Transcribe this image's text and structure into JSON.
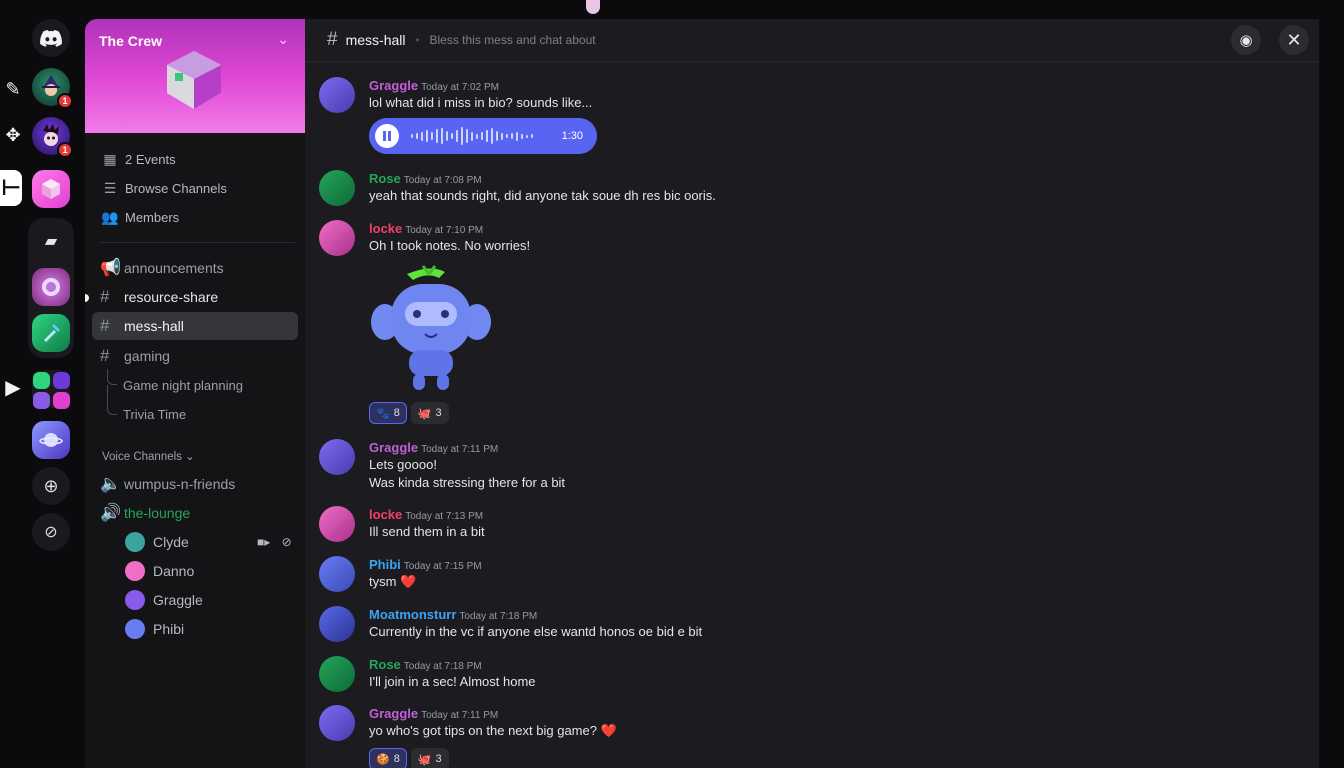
{
  "server": {
    "name": "The Crew",
    "badges": [
      "1",
      "1"
    ]
  },
  "sidebar": {
    "meta_items": [
      {
        "label": "2 Events",
        "icon": "calendar-icon"
      },
      {
        "label": "Browse Channels",
        "icon": "browse-channels-icon"
      },
      {
        "label": "Members",
        "icon": "members-icon"
      }
    ],
    "channels": [
      {
        "label": "announcements",
        "icon": "megaphone-icon"
      },
      {
        "label": "resource-share",
        "icon": "hash-icon"
      },
      {
        "label": "mess-hall",
        "icon": "hash-icon",
        "active": true
      },
      {
        "label": "gaming",
        "icon": "hash-icon"
      }
    ],
    "threads": [
      "Game night planning",
      "Trivia Time"
    ],
    "voice_section_label": "Voice Channels",
    "voice_channels": [
      "wumpus-n-friends",
      "the-lounge"
    ],
    "voice_users": [
      "Clyde",
      "Danno",
      "Graggle",
      "Phibi"
    ]
  },
  "chat": {
    "channel": "mess-hall",
    "topic": "Bless this mess and chat about",
    "voice_duration": "1:30",
    "messages": [
      {
        "author": "Graggle",
        "time": "Today at 7:02 PM",
        "lines": [
          "lol what did i miss in bio? sounds like..."
        ],
        "color": "#c25fd6"
      },
      {
        "author": "Rose",
        "time": "Today at 7:08 PM",
        "lines": [
          "yeah that sounds right, did anyone tak soue dh res bic ooris."
        ],
        "color": "#23a55a"
      },
      {
        "author": "locke",
        "time": "Today at 7:10 PM",
        "lines": [
          "Oh I took notes. No worries!"
        ],
        "color": "#f23f6b"
      },
      {
        "author": "Graggle",
        "time": "Today at 7:11 PM",
        "lines": [
          "Lets goooo!",
          "Was kinda stressing there for a bit"
        ],
        "color": "#c25fd6"
      },
      {
        "author": "locke",
        "time": "Today at 7:13 PM",
        "lines": [
          "Ill send them in a bit"
        ],
        "color": "#f23f6b"
      },
      {
        "author": "Phibi",
        "time": "Today at 7:15 PM",
        "lines": [
          "tysm ❤️"
        ],
        "color": "#3ba4f0"
      },
      {
        "author": "Moatmonsturr",
        "time": "Today at 7:18 PM",
        "lines": [
          "Currently in the vc if anyone else wantd honos oe bid e bit"
        ],
        "color": "#3ba4f0"
      },
      {
        "author": "Rose",
        "time": "Today at 7:18 PM",
        "lines": [
          "I'll join in a sec! Almost home"
        ],
        "color": "#23a55a"
      },
      {
        "author": "Graggle",
        "time": "Today at 7:11 PM",
        "lines": [
          "yo who's got tips on the next big game? ❤️"
        ],
        "color": "#c25fd6"
      }
    ],
    "reactions_1": [
      {
        "emoji": "🐾",
        "count": "8"
      },
      {
        "emoji": "🐙",
        "count": "3"
      }
    ],
    "reactions_2": [
      {
        "emoji": "🍪",
        "count": "8"
      },
      {
        "emoji": "🐙",
        "count": "3"
      }
    ]
  }
}
